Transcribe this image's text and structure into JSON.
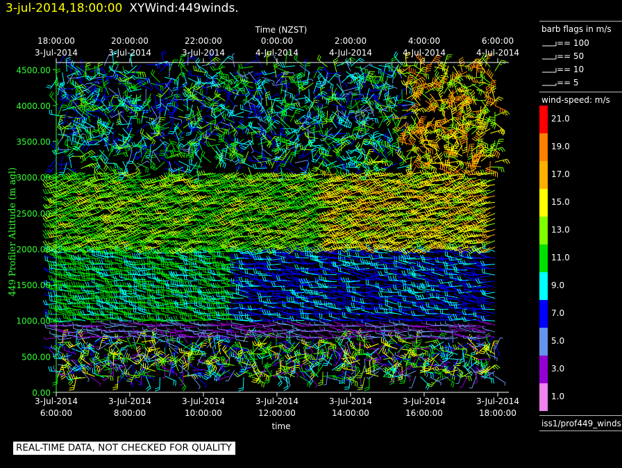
{
  "header": {
    "date_time": "3-jul-2014,18:00:00",
    "plot_name": "XYWind:449winds."
  },
  "warning": "REAL-TIME DATA, NOT CHECKED FOR QUALITY",
  "source": "iss1/prof449_winds",
  "legend": {
    "barb_title": "barb flags in m/s",
    "barbs": [
      {
        "label": "== 100",
        "value": 100
      },
      {
        "label": "== 50",
        "value": 50
      },
      {
        "label": "== 10",
        "value": 10
      },
      {
        "label": "== 5",
        "value": 5
      }
    ],
    "speed_title": "wind-speed: m/s",
    "speed_bins": [
      {
        "label": "21.0",
        "color": "#ff0000"
      },
      {
        "label": "19.0",
        "color": "#ff8000"
      },
      {
        "label": "17.0",
        "color": "#ffb000"
      },
      {
        "label": "15.0",
        "color": "#ffff00"
      },
      {
        "label": "13.0",
        "color": "#80ff00"
      },
      {
        "label": "11.0",
        "color": "#00e000"
      },
      {
        "label": "9.0",
        "color": "#00ffff"
      },
      {
        "label": "7.0",
        "color": "#0000ff"
      },
      {
        "label": "5.0",
        "color": "#6495ed"
      },
      {
        "label": "3.0",
        "color": "#9400d3"
      },
      {
        "label": "1.0",
        "color": "#ee82ee"
      }
    ]
  },
  "colors": {
    "axis_green": "#33ff33",
    "title_yellow": "#ffff00"
  },
  "chart_data": {
    "type": "wind barb time-height plot",
    "title": "XYWind:449winds.",
    "top_axis_label": "Time (NZST)",
    "bottom_axis_label": "time",
    "ylabel": "449 Profiler Altitude (m agl)",
    "ylim": [
      0,
      4600
    ],
    "y_ticks": [
      "0.00",
      "500.00",
      "1000.00",
      "1500.00",
      "2000.00",
      "2500.00",
      "3000.00",
      "3500.00",
      "4000.00",
      "4500.00"
    ],
    "top_ticks": [
      {
        "time": "18:00:00",
        "date": "3-Jul-2014"
      },
      {
        "time": "20:00:00",
        "date": "3-Jul-2014"
      },
      {
        "time": "22:00:00",
        "date": "3-Jul-2014"
      },
      {
        "time": "0:00:00",
        "date": "4-Jul-2014"
      },
      {
        "time": "2:00:00",
        "date": "4-Jul-2014"
      },
      {
        "time": "4:00:00",
        "date": "4-Jul-2014"
      },
      {
        "time": "6:00:00",
        "date": "4-Jul-2014"
      }
    ],
    "bottom_ticks": [
      {
        "date": "3-Jul-2014",
        "time": "6:00:00"
      },
      {
        "date": "3-Jul-2014",
        "time": "8:00:00"
      },
      {
        "date": "3-Jul-2014",
        "time": "10:00:00"
      },
      {
        "date": "3-Jul-2014",
        "time": "12:00:00"
      },
      {
        "date": "3-Jul-2014",
        "time": "14:00:00"
      },
      {
        "date": "3-Jul-2014",
        "time": "16:00:00"
      },
      {
        "date": "3-Jul-2014",
        "time": "18:00:00"
      }
    ],
    "x_range_hours": [
      6,
      18
    ]
  }
}
